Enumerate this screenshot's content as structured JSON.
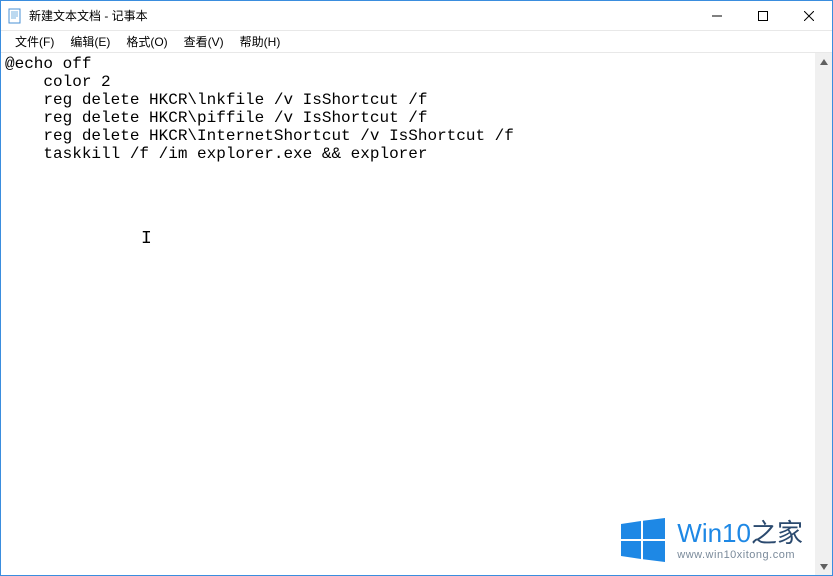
{
  "titlebar": {
    "title": "新建文本文档 - 记事本"
  },
  "menubar": {
    "file": "文件(F)",
    "edit": "编辑(E)",
    "format": "格式(O)",
    "view": "查看(V)",
    "help": "帮助(H)"
  },
  "editor": {
    "content": "@echo off\n    color 2\n    reg delete HKCR\\lnkfile /v IsShortcut /f\n    reg delete HKCR\\piffile /v IsShortcut /f\n    reg delete HKCR\\InternetShortcut /v IsShortcut /f\n    taskkill /f /im explorer.exe && explorer"
  },
  "watermark": {
    "brand_prefix": "Win10",
    "brand_suffix": "之家",
    "url": "www.win10xitong.com"
  }
}
